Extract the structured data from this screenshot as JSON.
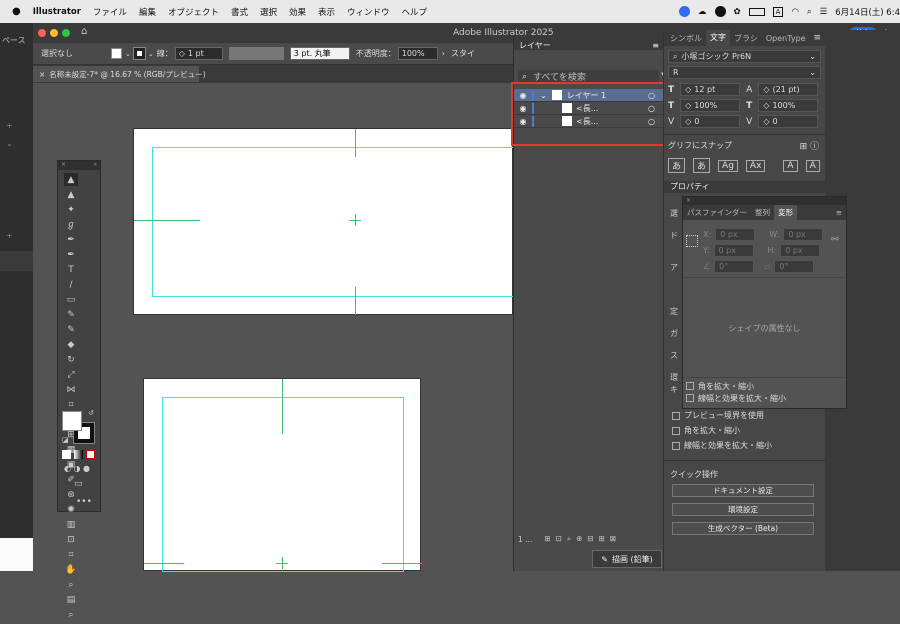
{
  "menubar": {
    "app": "Illustrator",
    "items": [
      "ファイル",
      "編集",
      "オブジェクト",
      "書式",
      "選択",
      "効果",
      "表示",
      "ウィンドウ",
      "ヘルプ"
    ],
    "datetime": "6月14日(土) 6:4",
    "share": "共有"
  },
  "window": {
    "title": "Adobe Illustrator 2025"
  },
  "leftstrip": {
    "label": "ペース"
  },
  "control": {
    "selection": "選択なし",
    "stroke_label": "線：",
    "stroke_value": "1 pt",
    "brush": "3 pt. 丸筆",
    "opacity_label": "不透明度：",
    "opacity_value": "100%",
    "style_label": "スタイ"
  },
  "doc_tab": {
    "label": "名称未設定-7* @ 16.67 % (RGB/プレビュー)"
  },
  "layers_panel": {
    "tab": "レイヤー",
    "search_placeholder": "すべてを検索",
    "rows": [
      {
        "name": "レイヤー 1"
      },
      {
        "name": "<長..."
      },
      {
        "name": "<長..."
      }
    ],
    "count": "1 ...",
    "draw_mode": "描画 (鉛筆)"
  },
  "char_panel": {
    "tabs": [
      "シンボル",
      "文字",
      "ブラシ",
      "OpenType"
    ],
    "font_family": "小塚ゴシック Pr6N",
    "font_style": "R",
    "size": "12 pt",
    "leading": "(21 pt)",
    "scale_v": "100%",
    "scale_h": "100%",
    "kerning": "0",
    "tracking": "0"
  },
  "snap": {
    "title": "グリフにスナップ"
  },
  "properties": {
    "tab": "プロパティ",
    "labels": [
      "選",
      "ド",
      "ア",
      "定",
      "ガ",
      "ス",
      "環",
      "キ"
    ],
    "checks": [
      "プレビュー境界を使用",
      "角を拡大・縮小",
      "線幅と効果を拡大・縮小"
    ],
    "quick_title": "クイック操作",
    "buttons": [
      "ドキュメント設定",
      "環境設定",
      "生成ベクター (Beta)"
    ]
  },
  "transform_panel": {
    "tabs": [
      "パスファインダー",
      "整列",
      "変形"
    ],
    "x_label": "X:",
    "x_value": "0 px",
    "y_label": "Y:",
    "y_value": "0 px",
    "w_label": "W:",
    "w_value": "0 px",
    "h_label": "H:",
    "h_value": "0 px",
    "angle_value": "0°",
    "shear_value": "0°",
    "empty_msg": "シェイプの属性なし",
    "checks": [
      "角を拡大・縮小",
      "線幅と効果を拡大・縮小"
    ]
  }
}
